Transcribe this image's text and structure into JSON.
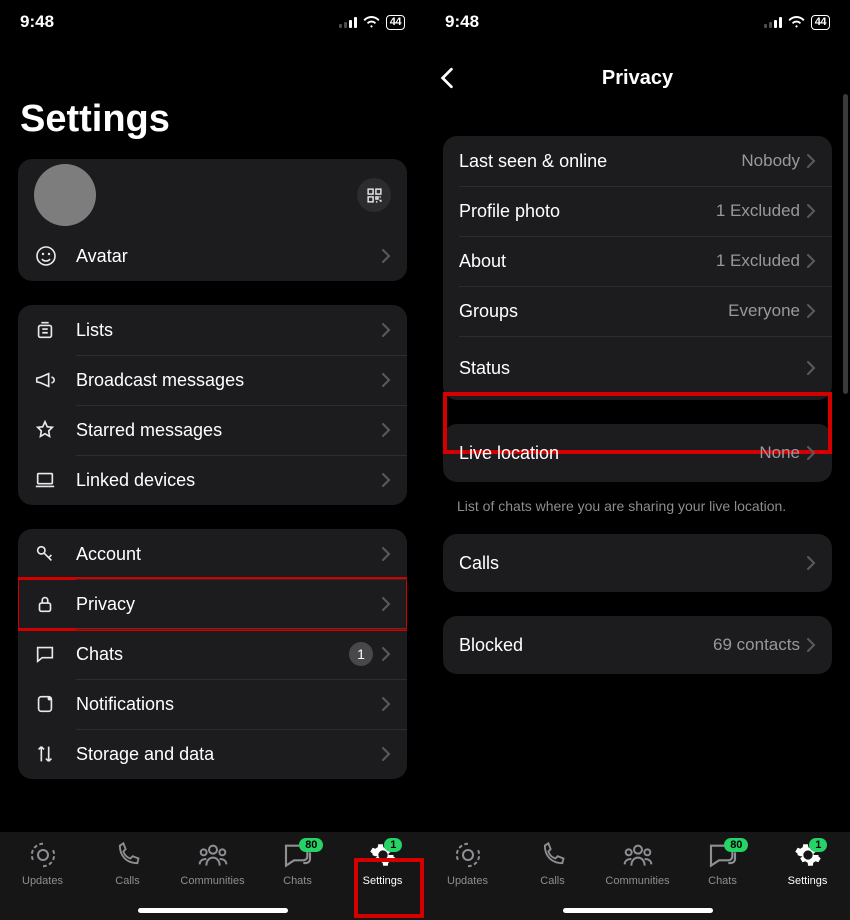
{
  "status": {
    "time": "9:48",
    "battery": "44"
  },
  "left": {
    "title": "Settings",
    "profile": {
      "name": ""
    },
    "avatar_row": "Avatar",
    "group1": [
      {
        "key": "lists",
        "label": "Lists"
      },
      {
        "key": "broadcast",
        "label": "Broadcast messages"
      },
      {
        "key": "starred",
        "label": "Starred messages"
      },
      {
        "key": "linked",
        "label": "Linked devices"
      }
    ],
    "group2": [
      {
        "key": "account",
        "label": "Account"
      },
      {
        "key": "privacy",
        "label": "Privacy",
        "highlight": true
      },
      {
        "key": "chats",
        "label": "Chats",
        "badge": "1"
      },
      {
        "key": "notifications",
        "label": "Notifications"
      },
      {
        "key": "storage",
        "label": "Storage and data"
      }
    ]
  },
  "right": {
    "title": "Privacy",
    "group1": [
      {
        "key": "lastseen",
        "label": "Last seen & online",
        "value": "Nobody"
      },
      {
        "key": "photo",
        "label": "Profile photo",
        "value": "1 Excluded"
      },
      {
        "key": "about",
        "label": "About",
        "value": "1 Excluded"
      },
      {
        "key": "groups",
        "label": "Groups",
        "value": "Everyone"
      },
      {
        "key": "status",
        "label": "Status",
        "highlight": true
      }
    ],
    "live": {
      "label": "Live location",
      "value": "None"
    },
    "live_note": "List of chats where you are sharing your live location.",
    "calls": {
      "label": "Calls"
    },
    "blocked": {
      "label": "Blocked",
      "value": "69 contacts"
    }
  },
  "tabs": [
    {
      "key": "updates",
      "label": "Updates"
    },
    {
      "key": "calls",
      "label": "Calls"
    },
    {
      "key": "communities",
      "label": "Communities"
    },
    {
      "key": "chats",
      "label": "Chats",
      "pill": "80"
    },
    {
      "key": "settings",
      "label": "Settings",
      "pill": "1",
      "active": true
    }
  ]
}
